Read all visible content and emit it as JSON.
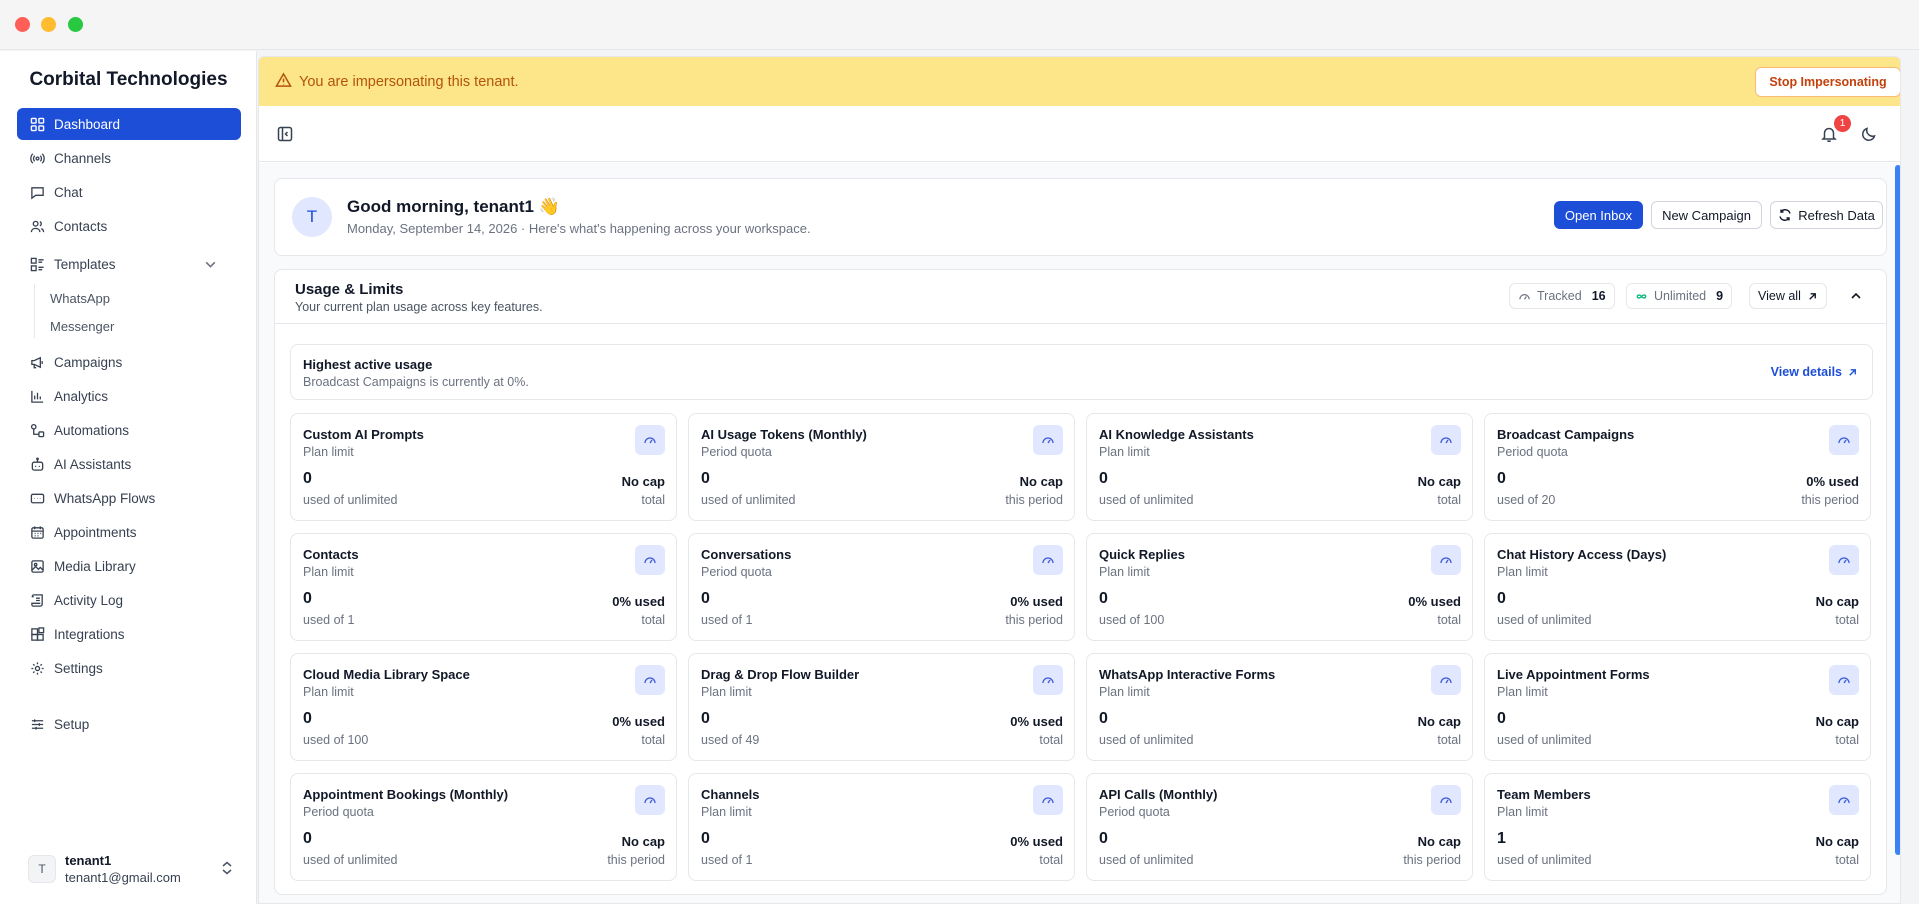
{
  "window": {
    "traffic_lights": [
      "close",
      "minimize",
      "zoom"
    ]
  },
  "sidebar": {
    "brand": "Corbital Technologies",
    "items": [
      {
        "label": "Dashboard",
        "icon": "grid-icon",
        "active": true
      },
      {
        "label": "Channels",
        "icon": "broadcast-icon"
      },
      {
        "label": "Chat",
        "icon": "message-square-icon"
      },
      {
        "label": "Contacts",
        "icon": "users-icon"
      },
      {
        "label": "Templates",
        "icon": "template-icon",
        "expanded": true
      },
      {
        "label": "Campaigns",
        "icon": "megaphone-icon"
      },
      {
        "label": "Analytics",
        "icon": "bar-chart-icon"
      },
      {
        "label": "Automations",
        "icon": "workflow-icon"
      },
      {
        "label": "AI Assistants",
        "icon": "bot-icon"
      },
      {
        "label": "WhatsApp Flows",
        "icon": "form-flow-icon"
      },
      {
        "label": "Appointments",
        "icon": "calendar-icon"
      },
      {
        "label": "Media Library",
        "icon": "image-icon"
      },
      {
        "label": "Activity Log",
        "icon": "scroll-log-icon"
      },
      {
        "label": "Integrations",
        "icon": "blocks-icon"
      },
      {
        "label": "Settings",
        "icon": "gear-icon"
      },
      {
        "label": "Setup",
        "icon": "sliders-icon"
      }
    ],
    "template_subitems": [
      "WhatsApp",
      "Messenger"
    ],
    "user": {
      "initial": "T",
      "name": "tenant1",
      "email": "tenant1@gmail.com"
    }
  },
  "banner": {
    "text": "You are impersonating this tenant.",
    "stop_label": "Stop Impersonating",
    "bg_color": "#fde68a"
  },
  "topbar": {
    "notification_count": "1"
  },
  "greeting": {
    "avatar_initial": "T",
    "title": "Good morning, tenant1 👋",
    "subtitle": "Monday, September 14, 2026 · Here's what's happening across your workspace.",
    "open_inbox": "Open Inbox",
    "new_campaign": "New Campaign",
    "refresh": "Refresh Data"
  },
  "usage": {
    "title": "Usage & Limits",
    "subtitle": "Your current plan usage across key features.",
    "tracked_label": "Tracked",
    "tracked_count": "16",
    "unlimited_label": "Unlimited",
    "unlimited_count": "9",
    "view_all": "View all",
    "highest": {
      "title": "Highest active usage",
      "subtitle": "Broadcast Campaigns is currently at 0%.",
      "link": "View details"
    },
    "metrics": [
      {
        "name": "Custom AI Prompts",
        "type": "Plan limit",
        "value": "0",
        "used": "used of unlimited",
        "cap": "No cap",
        "period": "total"
      },
      {
        "name": "AI Usage Tokens (Monthly)",
        "type": "Period quota",
        "value": "0",
        "used": "used of unlimited",
        "cap": "No cap",
        "period": "this period"
      },
      {
        "name": "AI Knowledge Assistants",
        "type": "Plan limit",
        "value": "0",
        "used": "used of unlimited",
        "cap": "No cap",
        "period": "total"
      },
      {
        "name": "Broadcast Campaigns",
        "type": "Period quota",
        "value": "0",
        "used": "used of 20",
        "cap": "0% used",
        "period": "this period"
      },
      {
        "name": "Contacts",
        "type": "Plan limit",
        "value": "0",
        "used": "used of 1",
        "cap": "0% used",
        "period": "total"
      },
      {
        "name": "Conversations",
        "type": "Period quota",
        "value": "0",
        "used": "used of 1",
        "cap": "0% used",
        "period": "this period"
      },
      {
        "name": "Quick Replies",
        "type": "Plan limit",
        "value": "0",
        "used": "used of 100",
        "cap": "0% used",
        "period": "total"
      },
      {
        "name": "Chat History Access (Days)",
        "type": "Plan limit",
        "value": "0",
        "used": "used of unlimited",
        "cap": "No cap",
        "period": "total"
      },
      {
        "name": "Cloud Media Library Space",
        "type": "Plan limit",
        "value": "0",
        "used": "used of 100",
        "cap": "0% used",
        "period": "total"
      },
      {
        "name": "Drag & Drop Flow Builder",
        "type": "Plan limit",
        "value": "0",
        "used": "used of 49",
        "cap": "0% used",
        "period": "total"
      },
      {
        "name": "WhatsApp Interactive Forms",
        "type": "Plan limit",
        "value": "0",
        "used": "used of unlimited",
        "cap": "No cap",
        "period": "total"
      },
      {
        "name": "Live Appointment Forms",
        "type": "Plan limit",
        "value": "0",
        "used": "used of unlimited",
        "cap": "No cap",
        "period": "total"
      },
      {
        "name": "Appointment Bookings (Monthly)",
        "type": "Period quota",
        "value": "0",
        "used": "used of unlimited",
        "cap": "No cap",
        "period": "this period"
      },
      {
        "name": "Channels",
        "type": "Plan limit",
        "value": "0",
        "used": "used of 1",
        "cap": "0% used",
        "period": "total"
      },
      {
        "name": "API Calls (Monthly)",
        "type": "Period quota",
        "value": "0",
        "used": "used of unlimited",
        "cap": "No cap",
        "period": "this period"
      },
      {
        "name": "Team Members",
        "type": "Plan limit",
        "value": "1",
        "used": "used of unlimited",
        "cap": "No cap",
        "period": "total"
      }
    ]
  },
  "colors": {
    "accent": "#1d4ed8",
    "banner_text": "#b45309",
    "badge": "#ef4444"
  }
}
